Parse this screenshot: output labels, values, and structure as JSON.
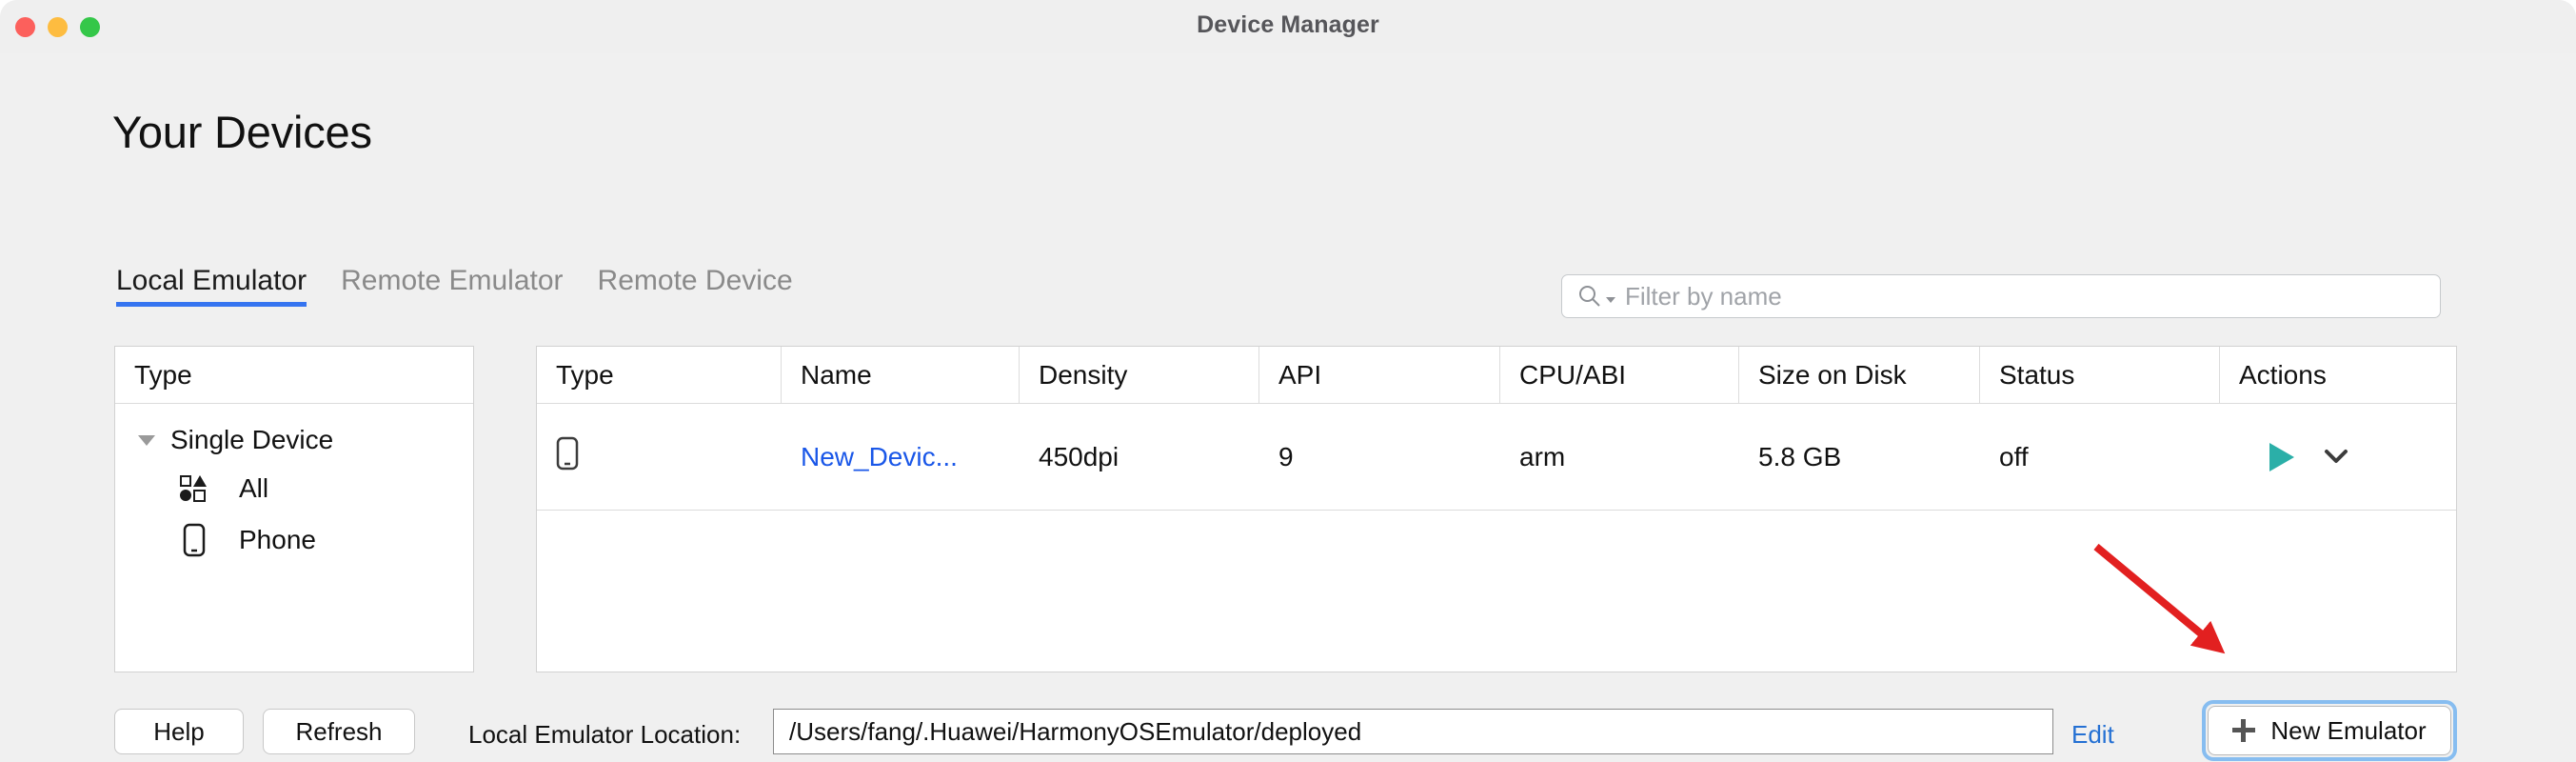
{
  "window": {
    "title": "Device Manager",
    "traffic_lights": [
      "close-red",
      "minimize-yellow",
      "zoom-green"
    ]
  },
  "page": {
    "heading": "Your Devices"
  },
  "tabs": [
    {
      "label": "Local Emulator",
      "active": true
    },
    {
      "label": "Remote Emulator",
      "active": false
    },
    {
      "label": "Remote Device",
      "active": false
    }
  ],
  "search": {
    "placeholder": "Filter by name",
    "value": "",
    "icon": "search-icon"
  },
  "sidebar": {
    "header": "Type",
    "group": {
      "label": "Single Device",
      "expanded": true
    },
    "items": [
      {
        "label": "All",
        "icon": "shapes-icon"
      },
      {
        "label": "Phone",
        "icon": "phone-icon"
      }
    ]
  },
  "table": {
    "columns": [
      "Type",
      "Name",
      "Density",
      "API",
      "CPU/ABI",
      "Size on Disk",
      "Status",
      "Actions"
    ],
    "rows": [
      {
        "type_icon": "phone-icon",
        "name": "New_Devic...",
        "density": "450dpi",
        "api": "9",
        "cpu_abi": "arm",
        "size_on_disk": "5.8 GB",
        "status": "off",
        "actions": [
          "run-play-icon",
          "chevron-down-icon"
        ]
      }
    ]
  },
  "footer": {
    "help_label": "Help",
    "refresh_label": "Refresh",
    "location_label": "Local Emulator Location:",
    "location_value": "/Users/fang/.Huawei/HarmonyOSEmulator/deployed",
    "edit_label": "Edit",
    "new_emulator_label": "New Emulator"
  },
  "annotation": {
    "type": "arrow",
    "color": "#e22020",
    "points_to": "new-emulator-button"
  },
  "colors": {
    "accent_blue": "#3574f0",
    "link_blue": "#1a57e8",
    "run_teal": "#2bafa8",
    "focus_ring": "#87bdf0",
    "window_bg": "#f0f0f0",
    "annotation_red": "#e22020"
  }
}
